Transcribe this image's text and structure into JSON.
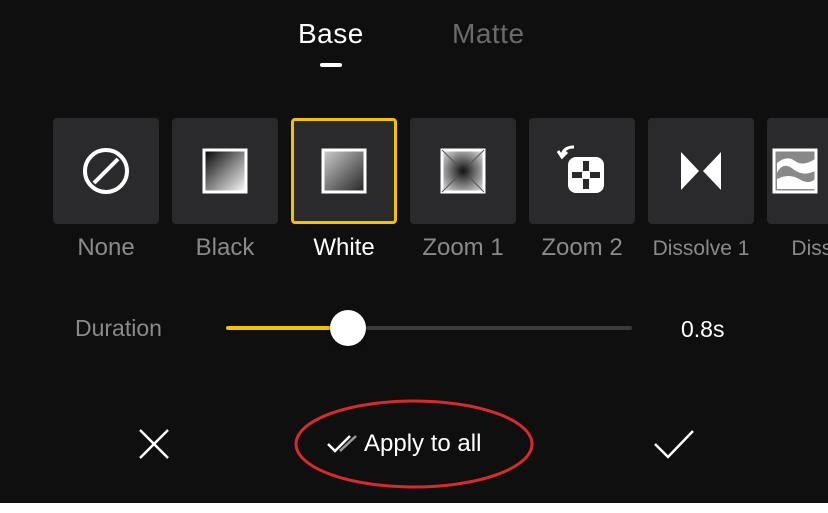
{
  "tabs": [
    {
      "label": "Base",
      "active": true
    },
    {
      "label": "Matte",
      "active": false
    }
  ],
  "transitions": [
    {
      "label": "None",
      "icon": "none-icon",
      "selected": false
    },
    {
      "label": "Black",
      "icon": "black-fade-icon",
      "selected": false
    },
    {
      "label": "White",
      "icon": "white-fade-icon",
      "selected": true
    },
    {
      "label": "Zoom 1",
      "icon": "zoom-in-icon",
      "selected": false
    },
    {
      "label": "Zoom 2",
      "icon": "zoom-rotate-icon",
      "selected": false
    },
    {
      "label": "Dissolve 1",
      "icon": "bowtie-icon",
      "selected": false
    },
    {
      "label": "Dissol",
      "icon": "dissolve-icon",
      "selected": false
    }
  ],
  "duration": {
    "label": "Duration",
    "value_text": "0.8s",
    "fraction": 0.3
  },
  "bottom_bar": {
    "apply_all_label": "Apply to all"
  },
  "colors": {
    "background": "#0f0f10",
    "accent": "#f2c200",
    "annotation": "#d62b2b"
  }
}
